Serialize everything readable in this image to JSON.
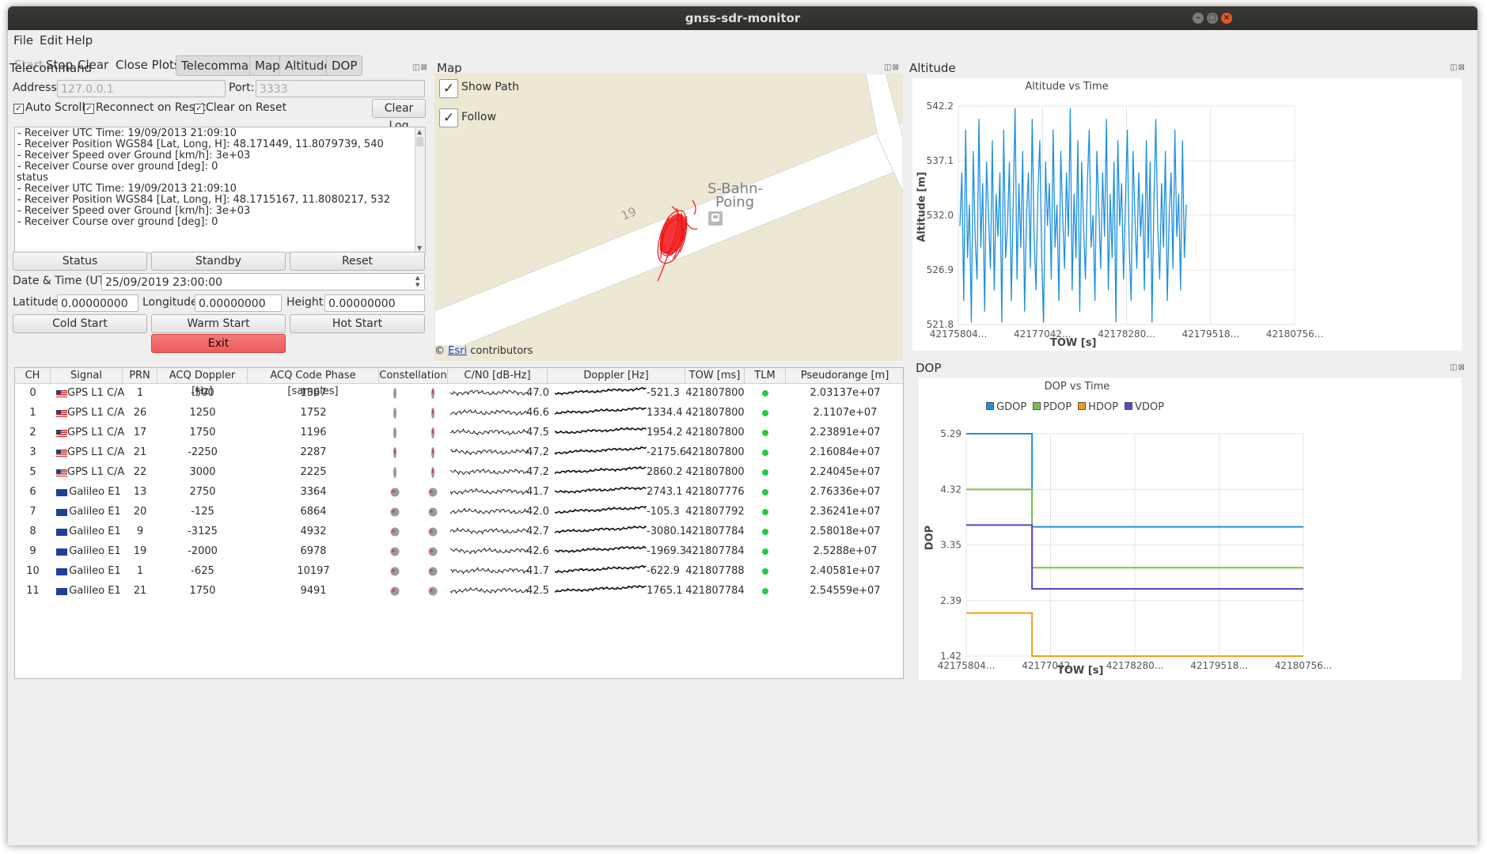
{
  "window": {
    "title": "gnss-sdr-monitor"
  },
  "menu": [
    "File",
    "Edit",
    "Help"
  ],
  "toolbar": {
    "start": "Start",
    "stop": "Stop",
    "clear": "Clear",
    "close_plots": "Close Plots",
    "telecommand": "Telecommand",
    "map": "Map",
    "altitude": "Altitude",
    "dop": "DOP"
  },
  "telecommand": {
    "title": "Telecommand",
    "address_label": "Address:",
    "address_value": "127.0.0.1",
    "port_label": "Port:",
    "port_value": "3333",
    "auto_scroll": "Auto Scroll",
    "reconnect_on_reset": "Reconnect on Reset",
    "clear_on_reset": "Clear on Reset",
    "clear_log": "Clear Log",
    "log": [
      "- Receiver UTC Time: 19/09/2013 21:09:10",
      "- Receiver Position WGS84 [Lat, Long, H]: 48.171449, 11.8079739, 540",
      "- Receiver Speed over Ground [km/h]: 3e+03",
      "- Receiver Course over ground [deg]: 0",
      "status",
      "- Receiver UTC Time: 19/09/2013 21:09:10",
      "- Receiver Position WGS84 [Lat, Long, H]: 48.1715167, 11.8080217, 532",
      "- Receiver Speed over Ground [km/h]: 3e+03",
      "- Receiver Course over ground [deg]: 0"
    ],
    "status_btn": "Status",
    "standby_btn": "Standby",
    "reset_btn": "Reset",
    "datetime_label": "Date & Time (UTC):",
    "datetime_value": "25/09/2019 23:00:00",
    "latitude_label": "Latitude:",
    "latitude_value": "0.00000000",
    "longitude_label": "Longitude:",
    "longitude_value": "0.00000000",
    "height_label": "Height:",
    "height_value": "0.00000000",
    "cold_start": "Cold Start",
    "warm_start": "Warm Start",
    "hot_start": "Hot Start",
    "exit": "Exit"
  },
  "map": {
    "title": "Map",
    "show_path": "Show Path",
    "follow": "Follow",
    "road_label": "19",
    "station_label_1": "S-Bahn-",
    "station_label_2": "Poing",
    "attribution_prefix": "©",
    "attribution_link": "Esri",
    "attribution_suffix": "contributors"
  },
  "table": {
    "headers": [
      "CH",
      "Signal",
      "PRN",
      "ACQ Doppler [Hz]",
      "ACQ Code Phase [samples]",
      "Constellation",
      "C/N0 [dB-Hz]",
      "Doppler [Hz]",
      "TOW [ms]",
      "TLM",
      "Pseudorange [m]"
    ],
    "rows": [
      {
        "ch": "0",
        "flag": "us",
        "signal": "GPS L1 C/A",
        "prn": "1",
        "acq_doppler": "-500",
        "code_phase": "1367",
        "cn0": "47.0",
        "doppler": "-521.3",
        "tow": "421807800",
        "pr": "2.03137e+07"
      },
      {
        "ch": "1",
        "flag": "us",
        "signal": "GPS L1 C/A",
        "prn": "26",
        "acq_doppler": "1250",
        "code_phase": "1752",
        "cn0": "46.6",
        "doppler": "1334.4",
        "tow": "421807800",
        "pr": "2.1107e+07"
      },
      {
        "ch": "2",
        "flag": "us",
        "signal": "GPS L1 C/A",
        "prn": "17",
        "acq_doppler": "1750",
        "code_phase": "1196",
        "cn0": "47.5",
        "doppler": "1954.2",
        "tow": "421807800",
        "pr": "2.23891e+07"
      },
      {
        "ch": "3",
        "flag": "us",
        "signal": "GPS L1 C/A",
        "prn": "21",
        "acq_doppler": "-2250",
        "code_phase": "2287",
        "cn0": "47.2",
        "doppler": "-2175.6",
        "tow": "421807800",
        "pr": "2.16084e+07"
      },
      {
        "ch": "5",
        "flag": "us",
        "signal": "GPS L1 C/A",
        "prn": "22",
        "acq_doppler": "3000",
        "code_phase": "2225",
        "cn0": "47.2",
        "doppler": "2860.2",
        "tow": "421807800",
        "pr": "2.24045e+07"
      },
      {
        "ch": "6",
        "flag": "eu",
        "signal": "Galileo E1",
        "prn": "13",
        "acq_doppler": "2750",
        "code_phase": "3364",
        "cn0": "41.7",
        "doppler": "2743.1",
        "tow": "421807776",
        "pr": "2.76336e+07"
      },
      {
        "ch": "7",
        "flag": "eu",
        "signal": "Galileo E1",
        "prn": "20",
        "acq_doppler": "-125",
        "code_phase": "6864",
        "cn0": "42.0",
        "doppler": "-105.3",
        "tow": "421807792",
        "pr": "2.36241e+07"
      },
      {
        "ch": "8",
        "flag": "eu",
        "signal": "Galileo E1",
        "prn": "9",
        "acq_doppler": "-3125",
        "code_phase": "4932",
        "cn0": "42.7",
        "doppler": "-3080.1",
        "tow": "421807784",
        "pr": "2.58018e+07"
      },
      {
        "ch": "9",
        "flag": "eu",
        "signal": "Galileo E1",
        "prn": "19",
        "acq_doppler": "-2000",
        "code_phase": "6978",
        "cn0": "42.6",
        "doppler": "-1969.3",
        "tow": "421807784",
        "pr": "2.5288e+07"
      },
      {
        "ch": "10",
        "flag": "eu",
        "signal": "Galileo E1",
        "prn": "1",
        "acq_doppler": "-625",
        "code_phase": "10197",
        "cn0": "41.7",
        "doppler": "-622.9",
        "tow": "421807788",
        "pr": "2.40581e+07"
      },
      {
        "ch": "11",
        "flag": "eu",
        "signal": "Galileo E1",
        "prn": "21",
        "acq_doppler": "1750",
        "code_phase": "9491",
        "cn0": "42.5",
        "doppler": "1765.1",
        "tow": "421807784",
        "pr": "2.54559e+07"
      }
    ]
  },
  "altitude": {
    "dock_title": "Altitude",
    "chart_title": "Altitude vs Time",
    "xlabel": "TOW [s]",
    "ylabel": "Altitude [m]",
    "yticks": [
      "542.2",
      "537.1",
      "532.0",
      "526.9",
      "521.8"
    ],
    "xticks": [
      "42175804...",
      "42177042...",
      "42178280...",
      "42179518...",
      "42180756..."
    ]
  },
  "dop": {
    "dock_title": "DOP",
    "chart_title": "DOP vs Time",
    "xlabel": "TOW [s]",
    "ylabel": "DOP",
    "yticks": [
      "5.29",
      "4.32",
      "3.35",
      "2.39",
      "1.42"
    ],
    "xticks": [
      "42175804...",
      "42177042...",
      "42178280...",
      "42179518...",
      "42180756..."
    ],
    "legend": [
      "GDOP",
      "PDOP",
      "HDOP",
      "VDOP"
    ]
  },
  "chart_data": [
    {
      "type": "line",
      "title": "Altitude vs Time",
      "xlabel": "TOW [s]",
      "ylabel": "Altitude [m]",
      "ylim": [
        521.8,
        542.2
      ],
      "series": [
        {
          "values": [
            531,
            536,
            524,
            540,
            528,
            533,
            522,
            538,
            530,
            526,
            541,
            529,
            535,
            523,
            537,
            532,
            527,
            539,
            525,
            534,
            530,
            536,
            522,
            540,
            528,
            531,
            537,
            524,
            533,
            542,
            526,
            535,
            529,
            538,
            523,
            532,
            536,
            527,
            541,
            530,
            525,
            534,
            539,
            528,
            522,
            537,
            531,
            535,
            526,
            540,
            529,
            533,
            524,
            538,
            532,
            527,
            536,
            530,
            542,
            525,
            534,
            528,
            539,
            523,
            537,
            531,
            526,
            535,
            540,
            529,
            532,
            524,
            538,
            533,
            527,
            536,
            530,
            541,
            525,
            534,
            528,
            537,
            522,
            539,
            531,
            535,
            526,
            533,
            540,
            529,
            524,
            538,
            532,
            527,
            536,
            530,
            534,
            525,
            539,
            528,
            537,
            522,
            533,
            541,
            531,
            526,
            535,
            529,
            538,
            524,
            532,
            536,
            527,
            540,
            530,
            534,
            525,
            539,
            528,
            533
          ]
        }
      ]
    },
    {
      "type": "line",
      "title": "DOP vs Time",
      "xlabel": "TOW [s]",
      "ylabel": "DOP",
      "ylim": [
        1.42,
        5.29
      ],
      "series": [
        {
          "name": "GDOP",
          "color": "#1e90e0",
          "values": [
            5.29,
            5.29,
            3.67,
            3.67
          ]
        },
        {
          "name": "PDOP",
          "color": "#7cc24a",
          "values": [
            4.32,
            4.32,
            2.96,
            2.96
          ]
        },
        {
          "name": "HDOP",
          "color": "#f0a01c",
          "values": [
            2.17,
            2.17,
            1.42,
            1.42
          ]
        },
        {
          "name": "VDOP",
          "color": "#5a46c8",
          "values": [
            3.7,
            3.7,
            2.59,
            2.59
          ]
        }
      ]
    }
  ]
}
